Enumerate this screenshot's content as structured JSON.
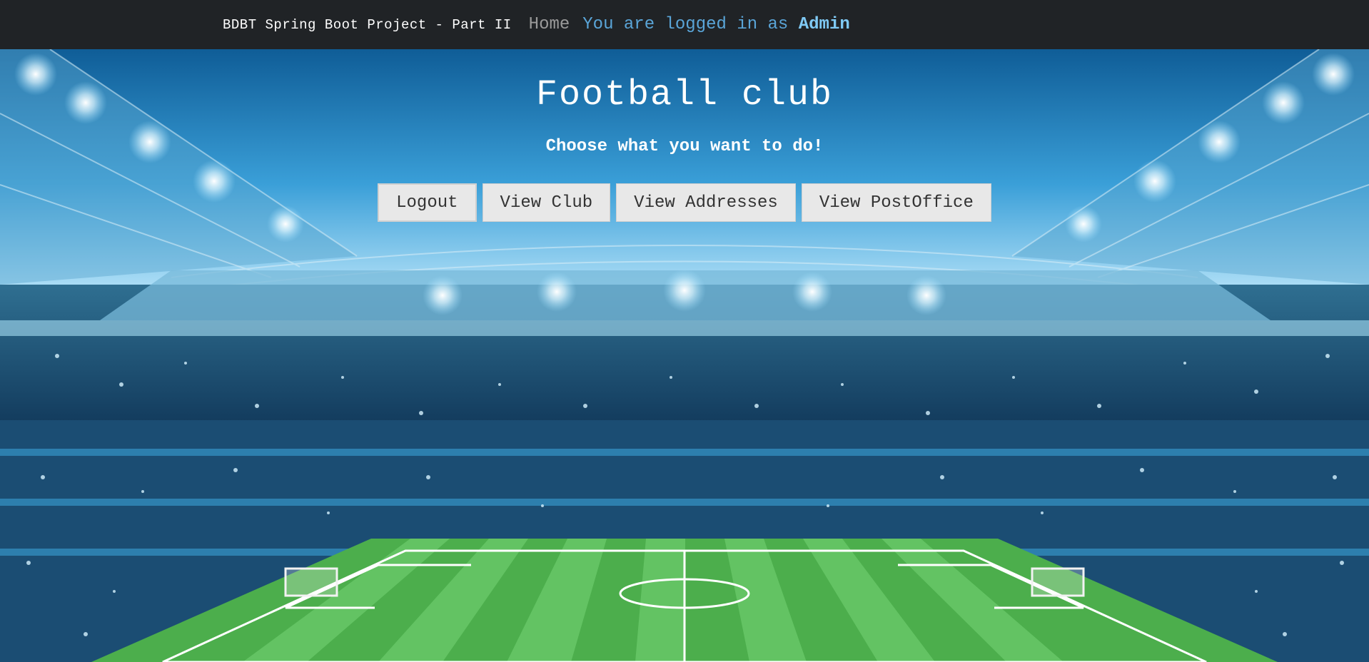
{
  "navbar": {
    "brand": "BDBT Spring Boot Project - Part II",
    "home_link": "Home",
    "logged_in_prefix": "You are logged in as",
    "username": "Admin"
  },
  "main": {
    "title": "Football club",
    "subtitle": "Choose what you want to do!",
    "buttons": {
      "logout": "Logout",
      "view_club": "View Club",
      "view_addresses": "View Addresses",
      "view_postoffice": "View PostOffice"
    }
  },
  "colors": {
    "navbar_bg": "#202326",
    "sky": "#2b8fd0",
    "pitch_green": "#4cae4c",
    "button_bg": "#e8e8e8"
  }
}
